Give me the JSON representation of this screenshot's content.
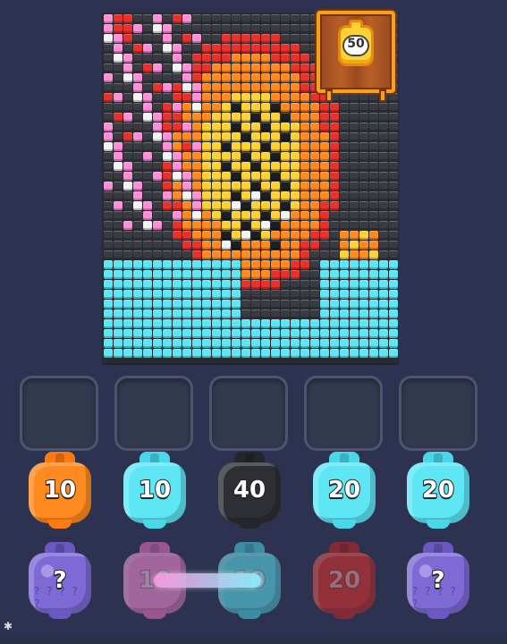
{
  "reward": {
    "value": "50"
  },
  "slots": [
    {},
    {},
    {},
    {},
    {}
  ],
  "row1": [
    {
      "label": "10",
      "color": "#ff8a1f",
      "cap": "#ff7a10"
    },
    {
      "label": "10",
      "color": "#5ee6f5",
      "cap": "#49d8ea"
    },
    {
      "label": "40",
      "color": "#2e2f34",
      "cap": "#25262b"
    },
    {
      "label": "20",
      "color": "#5ee6f5",
      "cap": "#49d8ea"
    },
    {
      "label": "20",
      "color": "#5ee6f5",
      "cap": "#49d8ea"
    }
  ],
  "row2": [
    {
      "label": "?",
      "color": "#7e6ad4",
      "cap": "#6b58c2",
      "kind": "mystery"
    },
    {
      "label": "10",
      "color": "#ff8fd8",
      "cap": "#f574c8",
      "kind": "locked"
    },
    {
      "label": "10",
      "color": "#5ee6f5",
      "cap": "#49d8ea",
      "kind": "locked"
    },
    {
      "label": "20",
      "color": "#e8312a",
      "cap": "#c92520",
      "kind": "locked"
    },
    {
      "label": "?",
      "color": "#7e6ad4",
      "cap": "#6b58c2",
      "kind": "mystery"
    }
  ],
  "palette": {
    "dark": "#2a2b31",
    "gray": "#3a3b42",
    "orange": "#ff8a1f",
    "yellow": "#ffd233",
    "red": "#e8312a",
    "pink": "#ff8fd8",
    "white": "#f4f4f4",
    "cyan": "#5ee6f5",
    "black": "#1d1e22"
  }
}
